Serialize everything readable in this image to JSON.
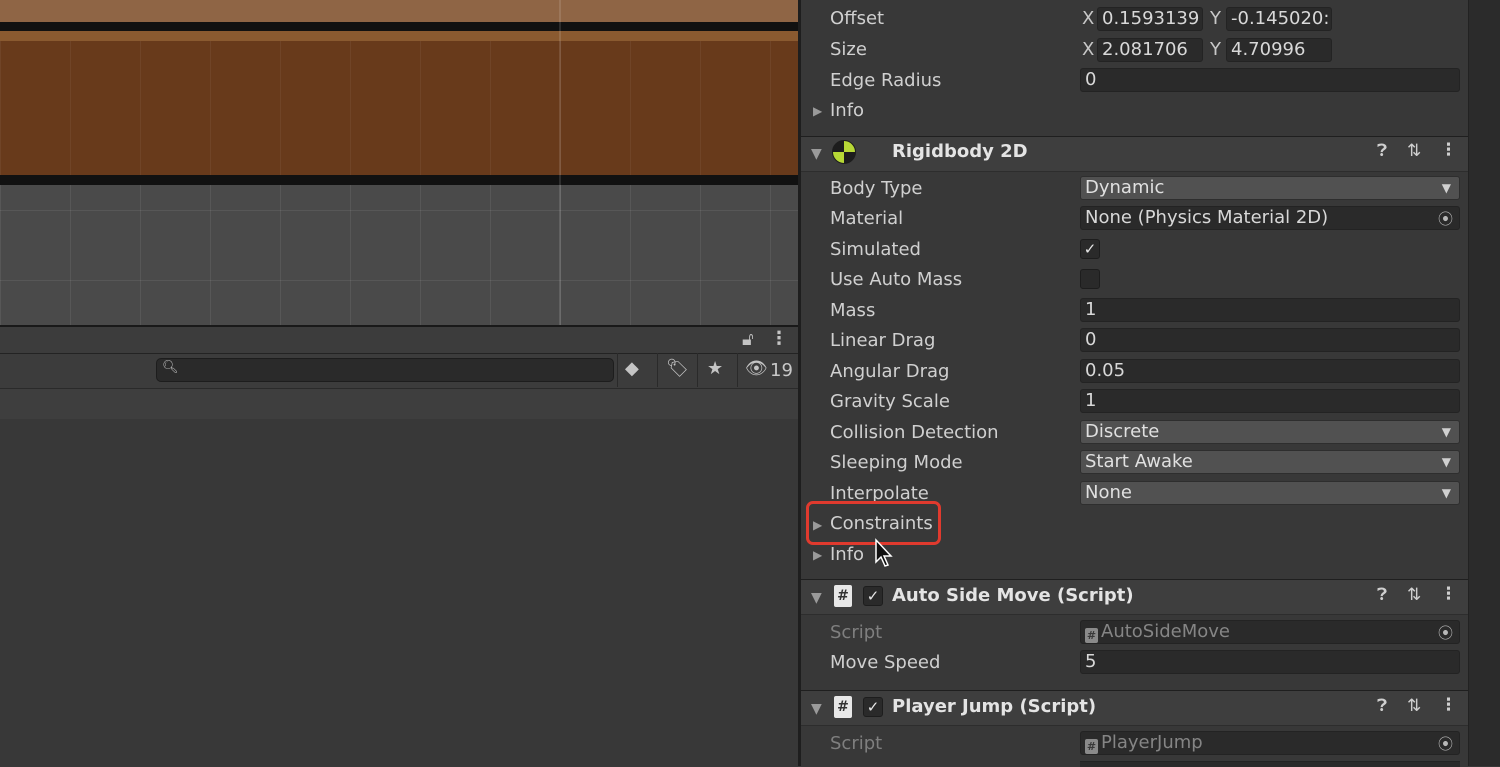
{
  "hierarchy": {
    "hidden_count": "19",
    "search_placeholder": ""
  },
  "collider": {
    "offset_label": "Offset",
    "offset_x_label": "X",
    "offset_x": "0.1593139",
    "offset_y_label": "Y",
    "offset_y": "-0.145020:",
    "size_label": "Size",
    "size_x_label": "X",
    "size_x": "2.081706",
    "size_y_label": "Y",
    "size_y": "4.70996",
    "edge_radius_label": "Edge Radius",
    "edge_radius": "0",
    "info_label": "Info"
  },
  "rigidbody": {
    "title": "Rigidbody 2D",
    "body_type_label": "Body Type",
    "body_type": "Dynamic",
    "material_label": "Material",
    "material": "None (Physics Material 2D)",
    "simulated_label": "Simulated",
    "simulated": true,
    "use_auto_mass_label": "Use Auto Mass",
    "use_auto_mass": false,
    "mass_label": "Mass",
    "mass": "1",
    "linear_drag_label": "Linear Drag",
    "linear_drag": "0",
    "angular_drag_label": "Angular Drag",
    "angular_drag": "0.05",
    "gravity_scale_label": "Gravity Scale",
    "gravity_scale": "1",
    "collision_detection_label": "Collision Detection",
    "collision_detection": "Discrete",
    "sleeping_mode_label": "Sleeping Mode",
    "sleeping_mode": "Start Awake",
    "interpolate_label": "Interpolate",
    "interpolate": "None",
    "constraints_label": "Constraints",
    "info_label": "Info"
  },
  "auto_side_move": {
    "title": "Auto Side Move (Script)",
    "enabled": true,
    "script_label": "Script",
    "script": "AutoSideMove",
    "move_speed_label": "Move Speed",
    "move_speed": "5"
  },
  "player_jump": {
    "title": "Player Jump (Script)",
    "enabled": true,
    "script_label": "Script",
    "script": "PlayerJump"
  },
  "colors": {
    "highlight": "#e03a2e",
    "ground": "#683a1b",
    "panel": "#383838"
  }
}
